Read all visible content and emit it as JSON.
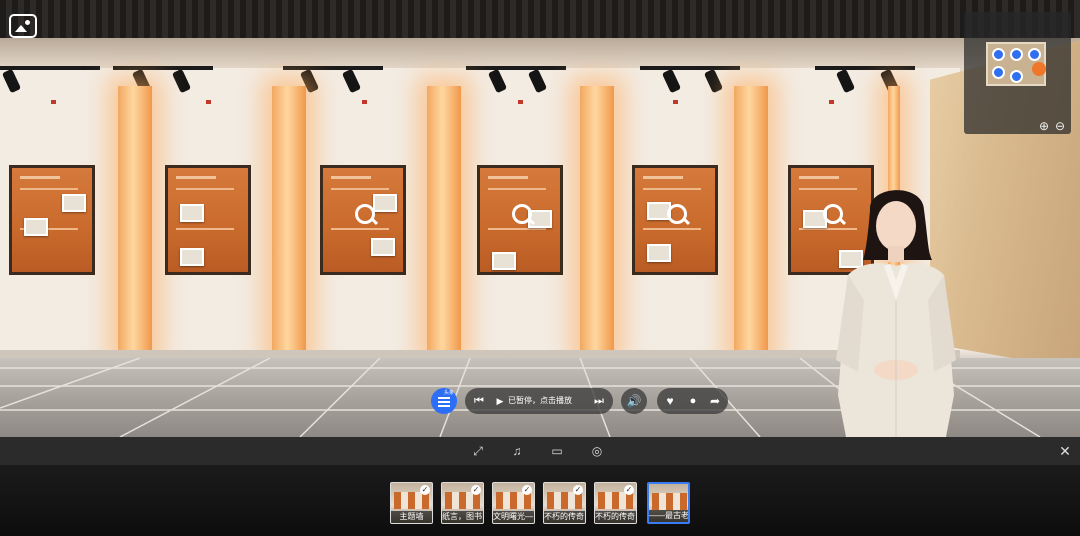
{
  "player": {
    "status_text": "已暂停，点击播放",
    "menu_tag": "头条"
  },
  "thumbnails": [
    {
      "label": "主题墙",
      "checked": true,
      "active": false
    },
    {
      "label": "纸言，图书…",
      "checked": true,
      "active": false
    },
    {
      "label": "文明曙光—…",
      "checked": true,
      "active": false
    },
    {
      "label": "不朽的传奇…",
      "checked": true,
      "active": false
    },
    {
      "label": "不朽的传奇…",
      "checked": true,
      "active": false
    },
    {
      "label": "——最古老版",
      "checked": false,
      "active": true
    }
  ],
  "icons": {
    "gallery": "image-gallery-icon",
    "menu": "menu-list-icon",
    "prev": "skip-previous-icon",
    "play": "play-icon",
    "next": "skip-next-icon",
    "volume": "volume-icon",
    "like": "heart-icon",
    "comment": "comment-icon",
    "share": "share-icon",
    "fullscreen": "fullscreen-icon",
    "music": "music-icon",
    "vr": "vr-glasses-icon",
    "gyro": "gyroscope-icon",
    "close": "close-icon",
    "zoom_in": "zoom-in-icon",
    "zoom_out": "zoom-out-icon"
  },
  "colors": {
    "accent": "#2c6ef5",
    "pillar": "#f2a860",
    "poster": "#c96a2c"
  }
}
